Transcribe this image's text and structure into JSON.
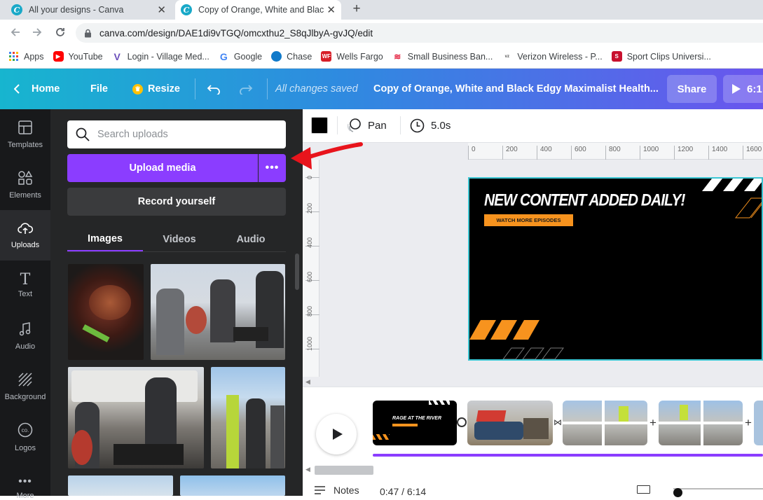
{
  "browser": {
    "tabs": [
      {
        "title": "All your designs - Canva"
      },
      {
        "title": "Copy of Orange, White and Black"
      }
    ],
    "url": "canva.com/design/DAE1di9vTGQ/omcxthu2_S8qJlbyA-gvJQ/edit",
    "bookmarks": [
      {
        "label": "Apps",
        "icon": "apps-grid-icon",
        "color": "#4285f4"
      },
      {
        "label": "YouTube",
        "icon": "youtube-icon",
        "color": "#ff0000"
      },
      {
        "label": "Login - Village Med...",
        "icon": "village-med-icon",
        "color": "#6b4fbb"
      },
      {
        "label": "Google",
        "icon": "google-icon",
        "color": "#4285f4"
      },
      {
        "label": "Chase",
        "icon": "chase-icon",
        "color": "#117aca"
      },
      {
        "label": "Wells Fargo",
        "icon": "wells-fargo-icon",
        "color": "#d71e28"
      },
      {
        "label": "Small Business Ban...",
        "icon": "bofa-icon",
        "color": "#e31837"
      },
      {
        "label": "Verizon Wireless - P...",
        "icon": "verizon-icon",
        "color": "#555555"
      },
      {
        "label": "Sport Clips Universi...",
        "icon": "sport-clips-icon",
        "color": "#c8102e"
      }
    ]
  },
  "header": {
    "home": "Home",
    "file": "File",
    "resize": "Resize",
    "saved_status": "All changes saved",
    "design_title": "Copy of Orange, White and Black Edgy Maximalist Health...",
    "share": "Share",
    "present_time": "6:1"
  },
  "rail": {
    "items": [
      {
        "label": "Templates",
        "icon": "templates-icon"
      },
      {
        "label": "Elements",
        "icon": "elements-icon"
      },
      {
        "label": "Uploads",
        "icon": "uploads-icon"
      },
      {
        "label": "Text",
        "icon": "text-icon"
      },
      {
        "label": "Audio",
        "icon": "audio-icon"
      },
      {
        "label": "Background",
        "icon": "background-icon"
      },
      {
        "label": "Logos",
        "icon": "logos-icon"
      },
      {
        "label": "More",
        "icon": "more-icon"
      }
    ]
  },
  "panel": {
    "search_placeholder": "Search uploads",
    "upload_media": "Upload media",
    "record_yourself": "Record yourself",
    "tabs": [
      "Images",
      "Videos",
      "Audio"
    ]
  },
  "toolbar": {
    "color": "#000000",
    "pan": "Pan",
    "duration": "5.0s"
  },
  "ruler": {
    "h_ticks": [
      "0",
      "200",
      "400",
      "600",
      "800",
      "1000",
      "1200",
      "1400",
      "1600"
    ],
    "v_ticks": [
      "0",
      "200",
      "400",
      "600",
      "800",
      "1000"
    ]
  },
  "design": {
    "headline": "NEW CONTENT ADDED DAILY!",
    "button_text": "WATCH MORE EPISODES",
    "accent": "#f7931e"
  },
  "timeline": {
    "clip1_title": "RAGE AT THE RIVER"
  },
  "footer": {
    "notes": "Notes",
    "time": "0:47 / 6:14"
  },
  "colors": {
    "canva_purple": "#8b3dff",
    "annotation_red": "#e8141c"
  }
}
